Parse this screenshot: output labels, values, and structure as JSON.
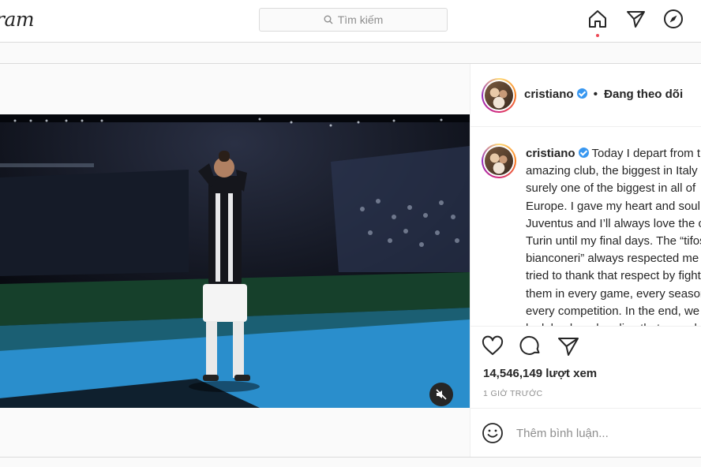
{
  "header": {
    "logo_text": "ram",
    "search_placeholder": "Tìm kiếm",
    "icons": [
      "search-icon",
      "home-icon",
      "direct-icon",
      "explore-icon"
    ]
  },
  "post": {
    "username": "cristiano",
    "follow_separator": "•",
    "follow_status": "Đang theo dõi",
    "caption": "Today I depart from this amazing club, the biggest in Italy and surely one of the biggest in all of Europe. I gave my heart and soul for Juventus and I’ll always love the city of Turin until my final days. The “tifosi bianconeri” always respected me and I tried to thank that respect by fighting for them in every game, every season, every competition. In the end, we can all look back and realize that we achieved great things, not all the",
    "views": "14,546,149 lượt xem",
    "time_ago": "1 GIỜ TRƯỚC",
    "comment_placeholder": "Thêm bình luận...",
    "video_muted": true
  },
  "colors": {
    "verified_blue": "#3897f0",
    "notification_dot": "#ed4956",
    "border": "#dbdbdb"
  }
}
